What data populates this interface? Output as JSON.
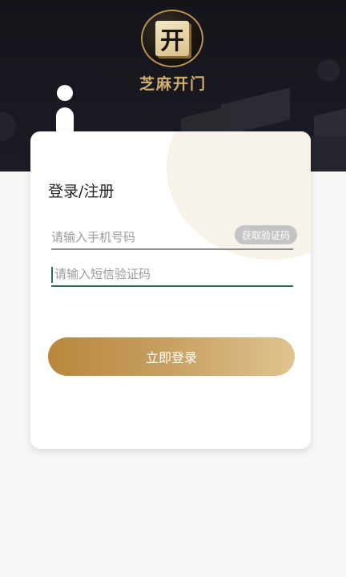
{
  "header": {
    "logo_glyph": "开",
    "app_name": "芝麻开门"
  },
  "login": {
    "title": "登录/注册",
    "phone_placeholder": "请输入手机号码",
    "code_placeholder": "请输入短信验证码",
    "get_code_label": "获取验证码",
    "submit_label": "立即登录"
  },
  "colors": {
    "header_bg": "#14141b",
    "accent_gold": "#c8a062",
    "focus_green": "#2d6e5e"
  }
}
